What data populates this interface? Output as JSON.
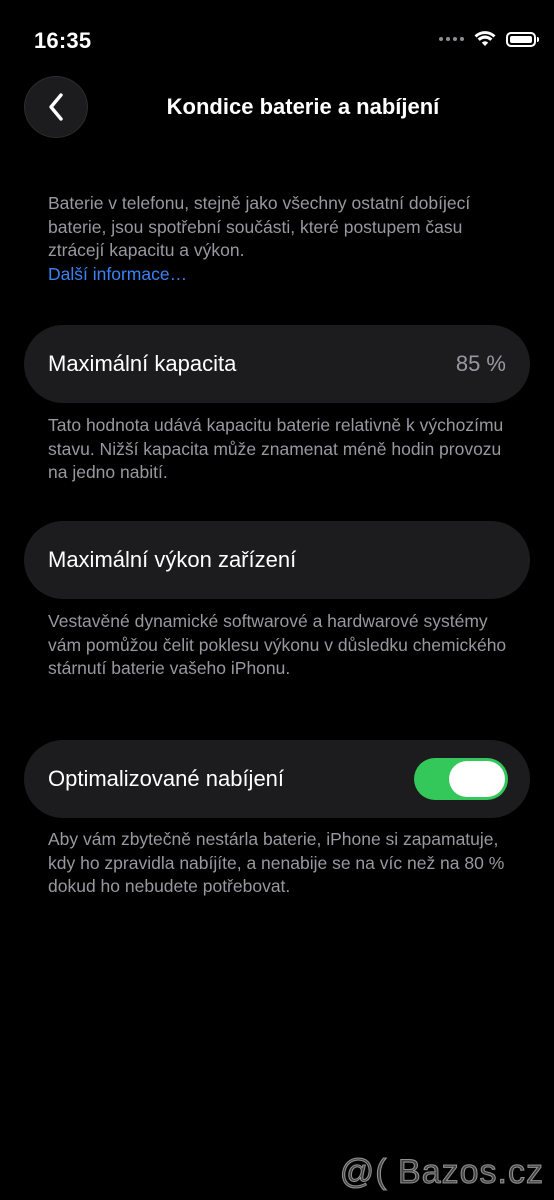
{
  "status_bar": {
    "time": "16:35"
  },
  "nav": {
    "title": "Kondice baterie a nabíjení",
    "back_icon": "chevron-left-icon"
  },
  "intro": {
    "text": "Baterie v telefonu, stejně jako všechny ostatní dobíjecí baterie, jsou spotřební součásti, které postupem času ztrácejí kapacitu a výkon.",
    "link": "Další informace…"
  },
  "capacity": {
    "label": "Maximální kapacita",
    "value": "85 %",
    "footer": "Tato hodnota udává kapacitu baterie relativně k výchozímu stavu. Nižší kapacita může znamenat méně hodin provozu na jedno nabití."
  },
  "performance": {
    "label": "Maximální výkon zařízení",
    "footer": "Vestavěné dynamické softwarové a hardwarové systémy vám pomůžou čelit poklesu výkonu v důsledku chemického stárnutí baterie vašeho iPhonu."
  },
  "optimized": {
    "label": "Optimalizované nabíjení",
    "enabled": true,
    "footer": "Aby vám zbytečně nestárla baterie, iPhone si zapamatuje, kdy ho zpravidla nabíjíte, a nenabije se na víc než na 80 % dokud ho nebudete potřebovat."
  },
  "watermark": {
    "text": "@( Bazos.cz"
  },
  "colors": {
    "background": "#000000",
    "card": "#1c1c1e",
    "secondary_text": "#98989f",
    "link": "#3b82f6",
    "toggle_on": "#34c759"
  }
}
